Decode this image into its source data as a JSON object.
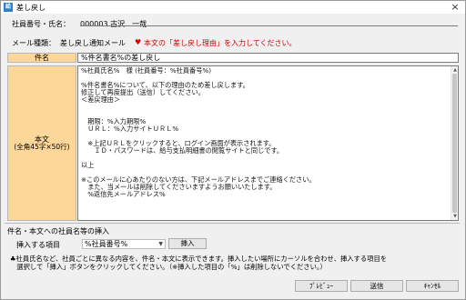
{
  "window": {
    "title": "差し戻し",
    "app_icon_text": "給",
    "close_label": "×"
  },
  "employee": {
    "label": "社員番号・氏名：",
    "value": "000003 古沢　一哉"
  },
  "mail_type": {
    "label": "メール種類：",
    "value": "差し戻し通知メール",
    "warning_icon": "♥",
    "warning_text": "本文の「差し戻し理由」を入力してください。"
  },
  "subject": {
    "label": "件名",
    "value": "%件名書名%の差し戻し"
  },
  "body": {
    "label_line1": "本文",
    "label_line2": "(全角45字×50行)",
    "text": "%社員氏名%　様 (社員番号：%社員番号%)\n\n%件名書名%について、以下の理由のため差し戻します。\n修正して再度提出（送信）してください。\n＜差戻理由＞\n\n\n　期限：%入力期限%\n　ＵＲＬ：%入力サイトＵＲＬ%\n\n　※上記ＵＲＬをクリックすると、ログイン画面が表示されます。\n　　ＩＤ・パスワードは、給与支払明細書の閲覧サイトと同じです。\n\n以上\n\n※このメールに心あたりのない方は、下記メールアドレスまでご連絡ください。\n　また、当メールは削除してくださいますようお願いいたします。\n　%返信先メールアドレス%"
  },
  "insert": {
    "section_title": "件名・本文への社員名等の挿入",
    "item_label": "挿入する項目",
    "selected_item": "%社員番号%",
    "insert_button": "挿入",
    "note_line1": "♣社員氏名など、社員ごとに異なる内容を、件名・本文に表示できます。挿入したい場所にカーソルを合わせ、挿入する項目を",
    "note_line2": "　選択して「挿入」ボタンをクリックしてください。（※挿入した項目の「%」は削除しないでください。）"
  },
  "footer": {
    "preview_button": "ﾌﾟﾚﾋﾞｭｰ",
    "send_button": "送信",
    "cancel_button": "ｷｬﾝｾﾙ"
  }
}
